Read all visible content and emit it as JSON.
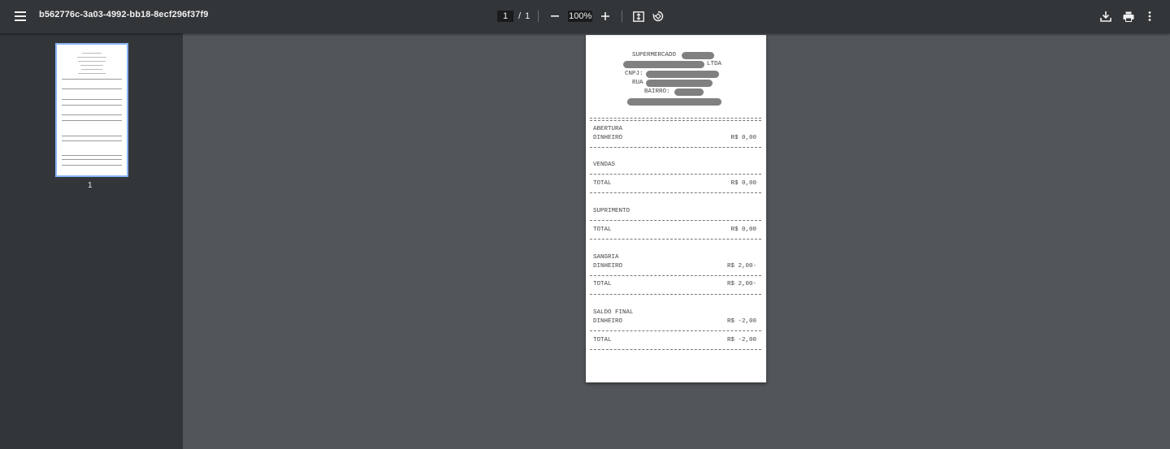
{
  "toolbar": {
    "menu_icon": "hamburger-menu-icon",
    "title": "b562776c-3a03-4992-bb18-8ecf296f37f9",
    "page_current": "1",
    "page_separator": "/",
    "page_total": "1",
    "zoom_out_icon": "minus-icon",
    "zoom_level": "100%",
    "zoom_in_icon": "plus-icon",
    "fit_icon": "fit-to-page-icon",
    "rotate_icon": "rotate-icon",
    "download_icon": "download-icon",
    "print_icon": "print-icon",
    "more_icon": "more-vert-icon"
  },
  "sidebar": {
    "thumbnail_page_label": "1"
  },
  "receipt": {
    "header": {
      "line1": "SUPERMERCADO",
      "line2_suffix": "LTDA",
      "line3": "CNPJ:",
      "line4": "RUA",
      "line5": "BAIRRO:"
    },
    "sections": {
      "abertura": "ABERTURA",
      "abertura_dinheiro_label": "DINHEIRO",
      "abertura_dinheiro_value": "R$ 0,00",
      "vendas": "VENDAS",
      "vendas_total_label": "TOTAL",
      "vendas_total_value": "R$ 0,00",
      "suprimento": "SUPRIMENTO",
      "suprimento_total_label": "TOTAL",
      "suprimento_total_value": "R$ 0,00",
      "sangria": "SANGRIA",
      "sangria_dinheiro_label": "DINHEIRO",
      "sangria_dinheiro_value": "R$ 2,00-",
      "sangria_total_label": "TOTAL",
      "sangria_total_value": "R$ 2,00-",
      "saldo": "SALDO FINAL",
      "saldo_dinheiro_label": "DINHEIRO",
      "saldo_dinheiro_value": "R$ -2,00",
      "saldo_total_label": "TOTAL",
      "saldo_total_value": "R$ -2,00"
    }
  }
}
